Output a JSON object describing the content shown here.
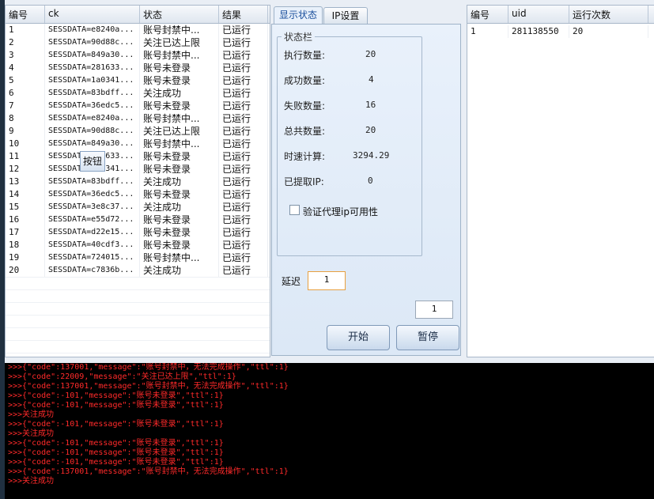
{
  "left_table": {
    "headers": [
      "编号",
      "ck",
      "状态",
      "结果"
    ],
    "rows": [
      [
        "1",
        "SESSDATA=e8240a...",
        "账号封禁中...",
        "已运行"
      ],
      [
        "2",
        "SESSDATA=90d88c...",
        "关注已达上限",
        "已运行"
      ],
      [
        "3",
        "SESSDATA=849a30...",
        "账号封禁中...",
        "已运行"
      ],
      [
        "4",
        "SESSDATA=281633...",
        "账号未登录",
        "已运行"
      ],
      [
        "5",
        "SESSDATA=1a0341...",
        "账号未登录",
        "已运行"
      ],
      [
        "6",
        "SESSDATA=83bdff...",
        "关注成功",
        "已运行"
      ],
      [
        "7",
        "SESSDATA=36edc5...",
        "账号未登录",
        "已运行"
      ],
      [
        "8",
        "SESSDATA=e8240a...",
        "账号封禁中...",
        "已运行"
      ],
      [
        "9",
        "SESSDATA=90d88c...",
        "关注已达上限",
        "已运行"
      ],
      [
        "10",
        "SESSDATA=849a30...",
        "账号封禁中...",
        "已运行"
      ],
      [
        "11",
        "SESSDATA=281633...",
        "账号未登录",
        "已运行"
      ],
      [
        "12",
        "SESSDATA=1a0341...",
        "账号未登录",
        "已运行"
      ],
      [
        "13",
        "SESSDATA=83bdff...",
        "关注成功",
        "已运行"
      ],
      [
        "14",
        "SESSDATA=36edc5...",
        "账号未登录",
        "已运行"
      ],
      [
        "15",
        "SESSDATA=3e8c37...",
        "关注成功",
        "已运行"
      ],
      [
        "16",
        "SESSDATA=e55d72...",
        "账号未登录",
        "已运行"
      ],
      [
        "17",
        "SESSDATA=d22e15...",
        "账号未登录",
        "已运行"
      ],
      [
        "18",
        "SESSDATA=40cdf3...",
        "账号未登录",
        "已运行"
      ],
      [
        "19",
        "SESSDATA=724015...",
        "账号封禁中...",
        "已运行"
      ],
      [
        "20",
        "SESSDATA=c7836b...",
        "关注成功",
        "已运行"
      ]
    ]
  },
  "floating_button": "按钮",
  "tabs": [
    "显示状态",
    "IP设置"
  ],
  "status_group": {
    "legend": "状态栏",
    "stats": [
      {
        "label": "执行数量:",
        "value": "20"
      },
      {
        "label": "成功数量:",
        "value": "4"
      },
      {
        "label": "失败数量:",
        "value": "16"
      },
      {
        "label": "总共数量:",
        "value": "20"
      },
      {
        "label": "时速计算:",
        "value": "3294.29"
      },
      {
        "label": "已提取IP:",
        "value": "0"
      }
    ],
    "checkbox_label": "验证代理ip可用性"
  },
  "delay": {
    "label": "延迟",
    "value": "1"
  },
  "count_input": "1",
  "buttons": {
    "start": "开始",
    "pause": "暂停"
  },
  "right_table": {
    "headers": [
      "编号",
      "uid",
      "运行次数"
    ],
    "rows": [
      [
        "1",
        "281138550",
        "20"
      ]
    ]
  },
  "log": [
    ">>>{\"code\":137001,\"message\":\"账号封禁中，无法完成操作\",\"ttl\":1}",
    ">>>{\"code\":22009,\"message\":\"关注已达上限\",\"ttl\":1}",
    ">>>{\"code\":137001,\"message\":\"账号封禁中，无法完成操作\",\"ttl\":1}",
    ">>>{\"code\":-101,\"message\":\"账号未登录\",\"ttl\":1}",
    ">>>{\"code\":-101,\"message\":\"账号未登录\",\"ttl\":1}",
    ">>>关注成功",
    ">>>{\"code\":-101,\"message\":\"账号未登录\",\"ttl\":1}",
    ">>>关注成功",
    ">>>{\"code\":-101,\"message\":\"账号未登录\",\"ttl\":1}",
    ">>>{\"code\":-101,\"message\":\"账号未登录\",\"ttl\":1}",
    ">>>{\"code\":-101,\"message\":\"账号未登录\",\"ttl\":1}",
    ">>>{\"code\":137001,\"message\":\"账号封禁中，无法完成操作\",\"ttl\":1}",
    ">>>关注成功"
  ],
  "colors": {
    "log_text": "#ff2a2a",
    "log_bg": "#000000",
    "accent": "#1a4f9c"
  }
}
